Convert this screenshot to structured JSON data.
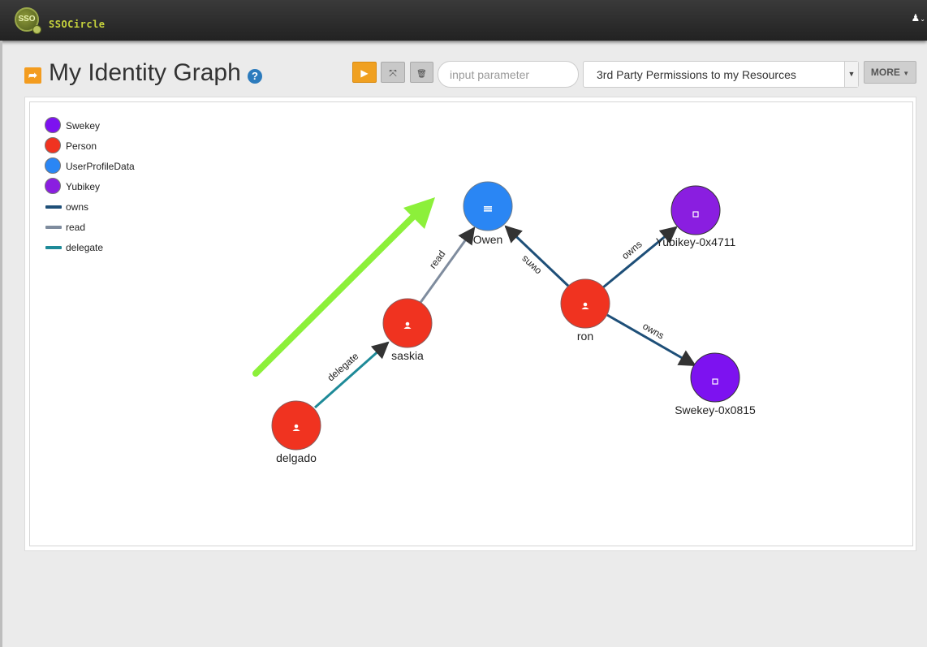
{
  "app": {
    "brand": "SSOCircle",
    "logo_text": "SSO",
    "user_icon": "user-icon"
  },
  "header": {
    "title": "My Identity Graph",
    "help_icon": "?",
    "play_icon": "▶",
    "expand_icon": "⤧",
    "delete_icon": "🗑",
    "param_placeholder": "input parameter",
    "query_selected": "3rd Party Permissions to my Resources",
    "more_label": "MORE"
  },
  "legend": {
    "nodes": [
      {
        "label": "Swekey",
        "color": "#7d12f0"
      },
      {
        "label": "Person",
        "color": "#f03320"
      },
      {
        "label": "UserProfileData",
        "color": "#2a86f4"
      },
      {
        "label": "Yubikey",
        "color": "#8a1ee0"
      }
    ],
    "edges": [
      {
        "label": "owns",
        "color": "#1e4f78"
      },
      {
        "label": "read",
        "color": "#7f8c9e"
      },
      {
        "label": "delegate",
        "color": "#1e8a98"
      }
    ]
  },
  "graph": {
    "nodes": [
      {
        "id": "owen",
        "label": "Owen",
        "type": "UserProfileData",
        "icon": "list-icon"
      },
      {
        "id": "yubikey",
        "label": "Yubikey-0x4711",
        "type": "Yubikey",
        "icon": "square-icon"
      },
      {
        "id": "saskia",
        "label": "saskia",
        "type": "Person",
        "icon": "person-icon"
      },
      {
        "id": "ron",
        "label": "ron",
        "type": "Person",
        "icon": "person-icon"
      },
      {
        "id": "swekey",
        "label": "Swekey-0x0815",
        "type": "Swekey",
        "icon": "square-icon"
      },
      {
        "id": "delgado",
        "label": "delgado",
        "type": "Person",
        "icon": "person-icon"
      }
    ],
    "edges": [
      {
        "from": "delgado",
        "to": "saskia",
        "label": "delegate",
        "type": "delegate"
      },
      {
        "from": "saskia",
        "to": "owen",
        "label": "read",
        "type": "read"
      },
      {
        "from": "ron",
        "to": "owen",
        "label": "owns",
        "type": "owns"
      },
      {
        "from": "ron",
        "to": "yubikey",
        "label": "owns",
        "type": "owns"
      },
      {
        "from": "ron",
        "to": "swekey",
        "label": "owns",
        "type": "owns"
      }
    ],
    "annotation": {
      "name": "green-arrow-annotation",
      "color": "#8cf03a"
    }
  }
}
